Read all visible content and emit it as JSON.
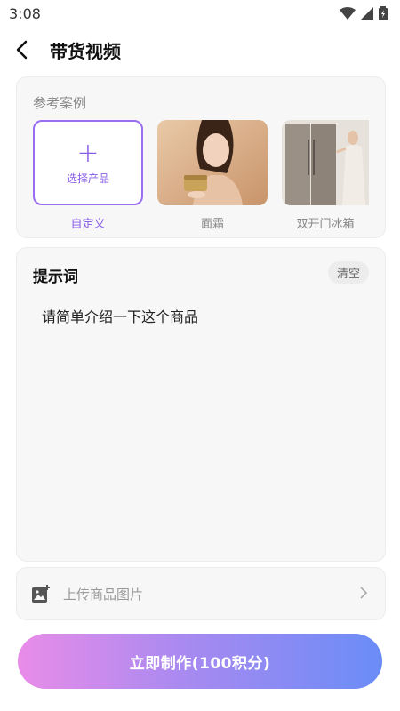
{
  "status": {
    "time": "3:08"
  },
  "header": {
    "title": "带货视频"
  },
  "reference": {
    "title": "参考案例",
    "custom_inner_label": "选择产品",
    "items": [
      {
        "caption": "自定义",
        "selected": true
      },
      {
        "caption": "面霜",
        "selected": false
      },
      {
        "caption": "双开门冰箱",
        "selected": false
      }
    ]
  },
  "prompt": {
    "title": "提示词",
    "clear_label": "清空",
    "text": "请简单介绍一下这个商品"
  },
  "upload": {
    "label": "上传商品图片"
  },
  "cta": {
    "label": "立即制作(100积分)"
  },
  "colors": {
    "accent": "#8a5fe8",
    "gradient_start": "#e98ce8",
    "gradient_end": "#6a8cf7"
  }
}
